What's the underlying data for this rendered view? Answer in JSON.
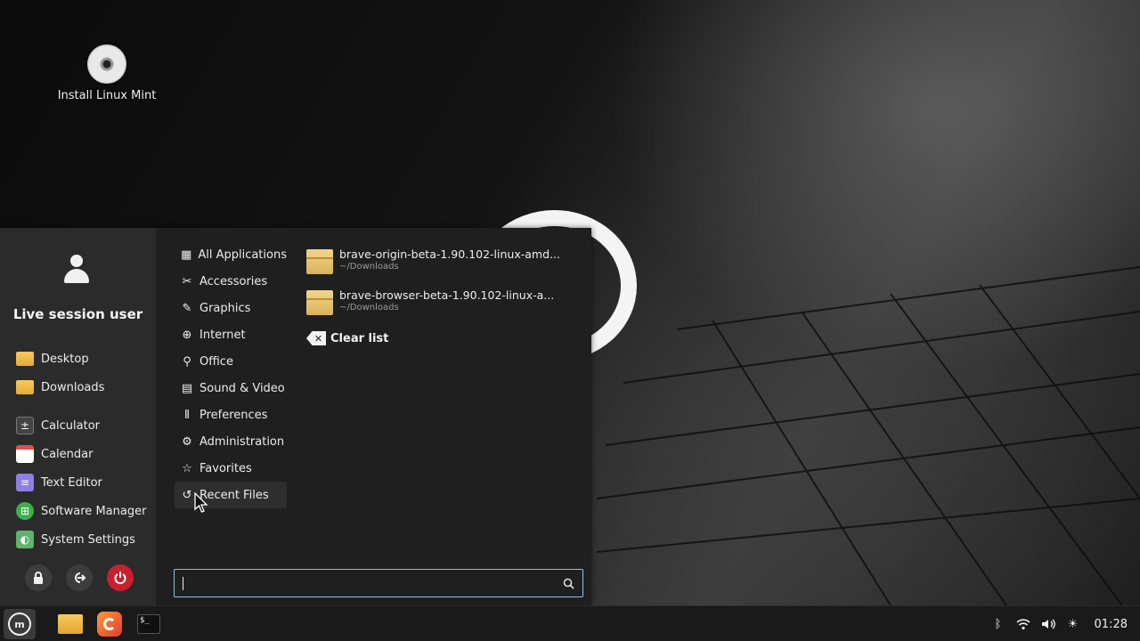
{
  "desktop": {
    "icons": [
      {
        "label": "Install Linux Mint",
        "icon": "disc-icon"
      }
    ]
  },
  "menu": {
    "user": {
      "name": "Live session user",
      "icon": "user-avatar-icon"
    },
    "places": [
      {
        "label": "Desktop",
        "icon": "folder-icon"
      },
      {
        "label": "Downloads",
        "icon": "folder-icon"
      }
    ],
    "favorites": [
      {
        "label": "Calculator",
        "icon": "calculator-icon"
      },
      {
        "label": "Calendar",
        "icon": "calendar-icon"
      },
      {
        "label": "Text Editor",
        "icon": "text-editor-icon"
      },
      {
        "label": "Software Manager",
        "icon": "software-manager-icon"
      },
      {
        "label": "System Settings",
        "icon": "system-settings-icon"
      }
    ],
    "session_buttons": [
      {
        "name": "lock",
        "icon": "lock-icon"
      },
      {
        "name": "logout",
        "icon": "logout-icon"
      },
      {
        "name": "power",
        "icon": "power-icon"
      }
    ],
    "categories": [
      {
        "label": "All Applications",
        "icon": "grid-icon"
      },
      {
        "label": "Accessories",
        "icon": "tools-icon"
      },
      {
        "label": "Graphics",
        "icon": "palette-icon"
      },
      {
        "label": "Internet",
        "icon": "globe-icon"
      },
      {
        "label": "Office",
        "icon": "paperclip-icon"
      },
      {
        "label": "Sound & Video",
        "icon": "film-icon"
      },
      {
        "label": "Preferences",
        "icon": "sliders-icon"
      },
      {
        "label": "Administration",
        "icon": "gear-icon"
      },
      {
        "label": "Favorites",
        "icon": "star-icon"
      },
      {
        "label": "Recent Files",
        "icon": "history-icon"
      }
    ],
    "active_category": "Recent Files",
    "recent_files": [
      {
        "name": "brave-origin-beta-1.90.102-linux-amd...",
        "path": "~/Downloads",
        "icon": "package-icon"
      },
      {
        "name": "brave-browser-beta-1.90.102-linux-a...",
        "path": "~/Downloads",
        "icon": "package-icon"
      }
    ],
    "clear_label": "Clear list",
    "search": {
      "value": "",
      "placeholder": ""
    }
  },
  "taskbar": {
    "apps": [
      {
        "name": "menu",
        "icon": "mint-logo-icon"
      },
      {
        "name": "files",
        "icon": "folder-icon"
      },
      {
        "name": "firefox",
        "icon": "firefox-icon"
      },
      {
        "name": "terminal",
        "icon": "terminal-icon"
      }
    ],
    "tray": [
      "bluetooth-icon",
      "wifi-icon",
      "volume-icon",
      "brightness-icon"
    ],
    "clock": "01:28"
  },
  "colors": {
    "accent_power": "#c8202f",
    "menu_bg": "#1f1f1f",
    "sidebar_bg": "#2b2b2b",
    "search_border": "#8fc4e8"
  }
}
